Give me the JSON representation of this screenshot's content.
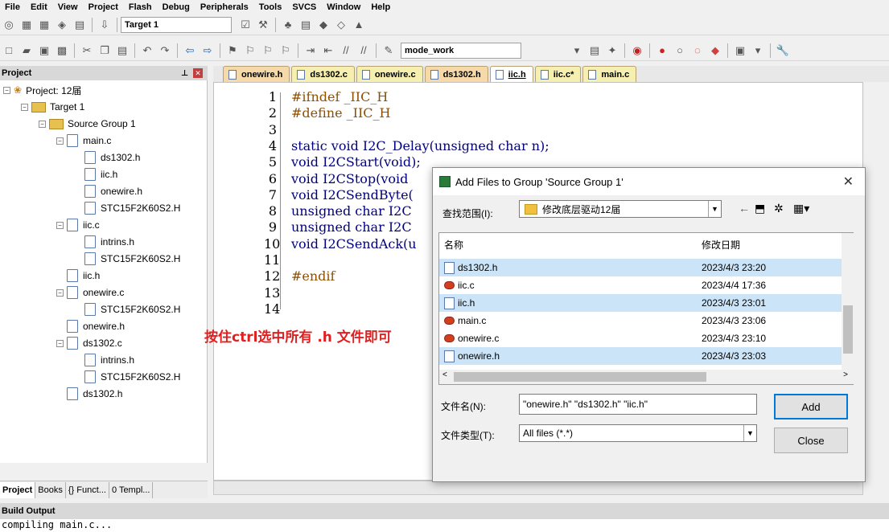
{
  "menu": [
    "File",
    "Edit",
    "View",
    "Project",
    "Flash",
    "Debug",
    "Peripherals",
    "Tools",
    "SVCS",
    "Window",
    "Help"
  ],
  "toolbar": {
    "target": "Target 1",
    "mode": "mode_work"
  },
  "project_panel": {
    "title": "Project",
    "items": [
      {
        "label": "Project: 12届",
        "level": 0,
        "type": "project",
        "exp": "-"
      },
      {
        "label": "Target 1",
        "level": 1,
        "type": "target",
        "exp": "-"
      },
      {
        "label": "Source Group 1",
        "level": 2,
        "type": "folder",
        "exp": "-"
      },
      {
        "label": "main.c",
        "level": 3,
        "type": "file",
        "exp": "-"
      },
      {
        "label": "ds1302.h",
        "level": 4,
        "type": "file",
        "exp": ""
      },
      {
        "label": "iic.h",
        "level": 4,
        "type": "file",
        "exp": ""
      },
      {
        "label": "onewire.h",
        "level": 4,
        "type": "file",
        "exp": ""
      },
      {
        "label": "STC15F2K60S2.H",
        "level": 4,
        "type": "file",
        "exp": ""
      },
      {
        "label": "iic.c",
        "level": 3,
        "type": "file",
        "exp": "-"
      },
      {
        "label": "intrins.h",
        "level": 4,
        "type": "file",
        "exp": ""
      },
      {
        "label": "STC15F2K60S2.H",
        "level": 4,
        "type": "file",
        "exp": ""
      },
      {
        "label": "iic.h",
        "level": 3,
        "type": "file",
        "exp": ""
      },
      {
        "label": "onewire.c",
        "level": 3,
        "type": "file",
        "exp": "-"
      },
      {
        "label": "STC15F2K60S2.H",
        "level": 4,
        "type": "file",
        "exp": ""
      },
      {
        "label": "onewire.h",
        "level": 3,
        "type": "file",
        "exp": ""
      },
      {
        "label": "ds1302.c",
        "level": 3,
        "type": "file",
        "exp": "-"
      },
      {
        "label": "intrins.h",
        "level": 4,
        "type": "file",
        "exp": ""
      },
      {
        "label": "STC15F2K60S2.H",
        "level": 4,
        "type": "file",
        "exp": ""
      },
      {
        "label": "ds1302.h",
        "level": 3,
        "type": "file",
        "exp": ""
      }
    ],
    "bottom_tabs": [
      "Project",
      "Books",
      "{} Funct...",
      "0 Templ..."
    ]
  },
  "editor_tabs": [
    {
      "label": "onewire.h",
      "color": "#f5d9a8"
    },
    {
      "label": "ds1302.c",
      "color": "#f5efb0"
    },
    {
      "label": "onewire.c",
      "color": "#f5efb0"
    },
    {
      "label": "ds1302.h",
      "color": "#f5d9a8"
    },
    {
      "label": "iic.h",
      "color": "#ffffff",
      "active": true
    },
    {
      "label": "iic.c*",
      "color": "#f5efb0"
    },
    {
      "label": "main.c",
      "color": "#f5efb0"
    }
  ],
  "code_lines": [
    {
      "n": "1",
      "t": "#ifndef _IIC_H"
    },
    {
      "n": "2",
      "t": "#define _IIC_H"
    },
    {
      "n": "3",
      "t": ""
    },
    {
      "n": "4",
      "t": "static void I2C_Delay(unsigned char n);"
    },
    {
      "n": "5",
      "t": "void I2CStart(void);"
    },
    {
      "n": "6",
      "t": "void I2CStop(void"
    },
    {
      "n": "7",
      "t": "void I2CSendByte("
    },
    {
      "n": "8",
      "t": "unsigned char I2C"
    },
    {
      "n": "9",
      "t": "unsigned char I2C"
    },
    {
      "n": "10",
      "t": "void I2CSendAck(u"
    },
    {
      "n": "11",
      "t": ""
    },
    {
      "n": "12",
      "t": "#endif"
    },
    {
      "n": "13",
      "t": ""
    },
    {
      "n": "14",
      "t": ""
    }
  ],
  "annotation": "按住ctrl选中所有 .h 文件即可",
  "build_output": {
    "title": "Build Output",
    "line": "compiling main.c..."
  },
  "dialog": {
    "title": "Add Files to Group 'Source Group 1'",
    "look_in_label": "查找范围(I):",
    "look_in_value": "修改底层驱动12届",
    "col_name": "名称",
    "col_date": "修改日期",
    "files": [
      {
        "name": "ds1302.h",
        "date": "2023/4/3 23:20",
        "kind": "h",
        "selected": true
      },
      {
        "name": "iic.c",
        "date": "2023/4/4 17:36",
        "kind": "c",
        "selected": false
      },
      {
        "name": "iic.h",
        "date": "2023/4/3 23:01",
        "kind": "h",
        "selected": true
      },
      {
        "name": "main.c",
        "date": "2023/4/3 23:06",
        "kind": "c",
        "selected": false
      },
      {
        "name": "onewire.c",
        "date": "2023/4/3 23:10",
        "kind": "c",
        "selected": false
      },
      {
        "name": "onewire.h",
        "date": "2023/4/3 23:03",
        "kind": "h",
        "selected": true
      }
    ],
    "filename_label": "文件名(N):",
    "filename_value": "\"onewire.h\" \"ds1302.h\" \"iic.h\"",
    "filetype_label": "文件类型(T):",
    "filetype_value": "All files (*.*)",
    "add_label": "Add",
    "close_label": "Close"
  }
}
